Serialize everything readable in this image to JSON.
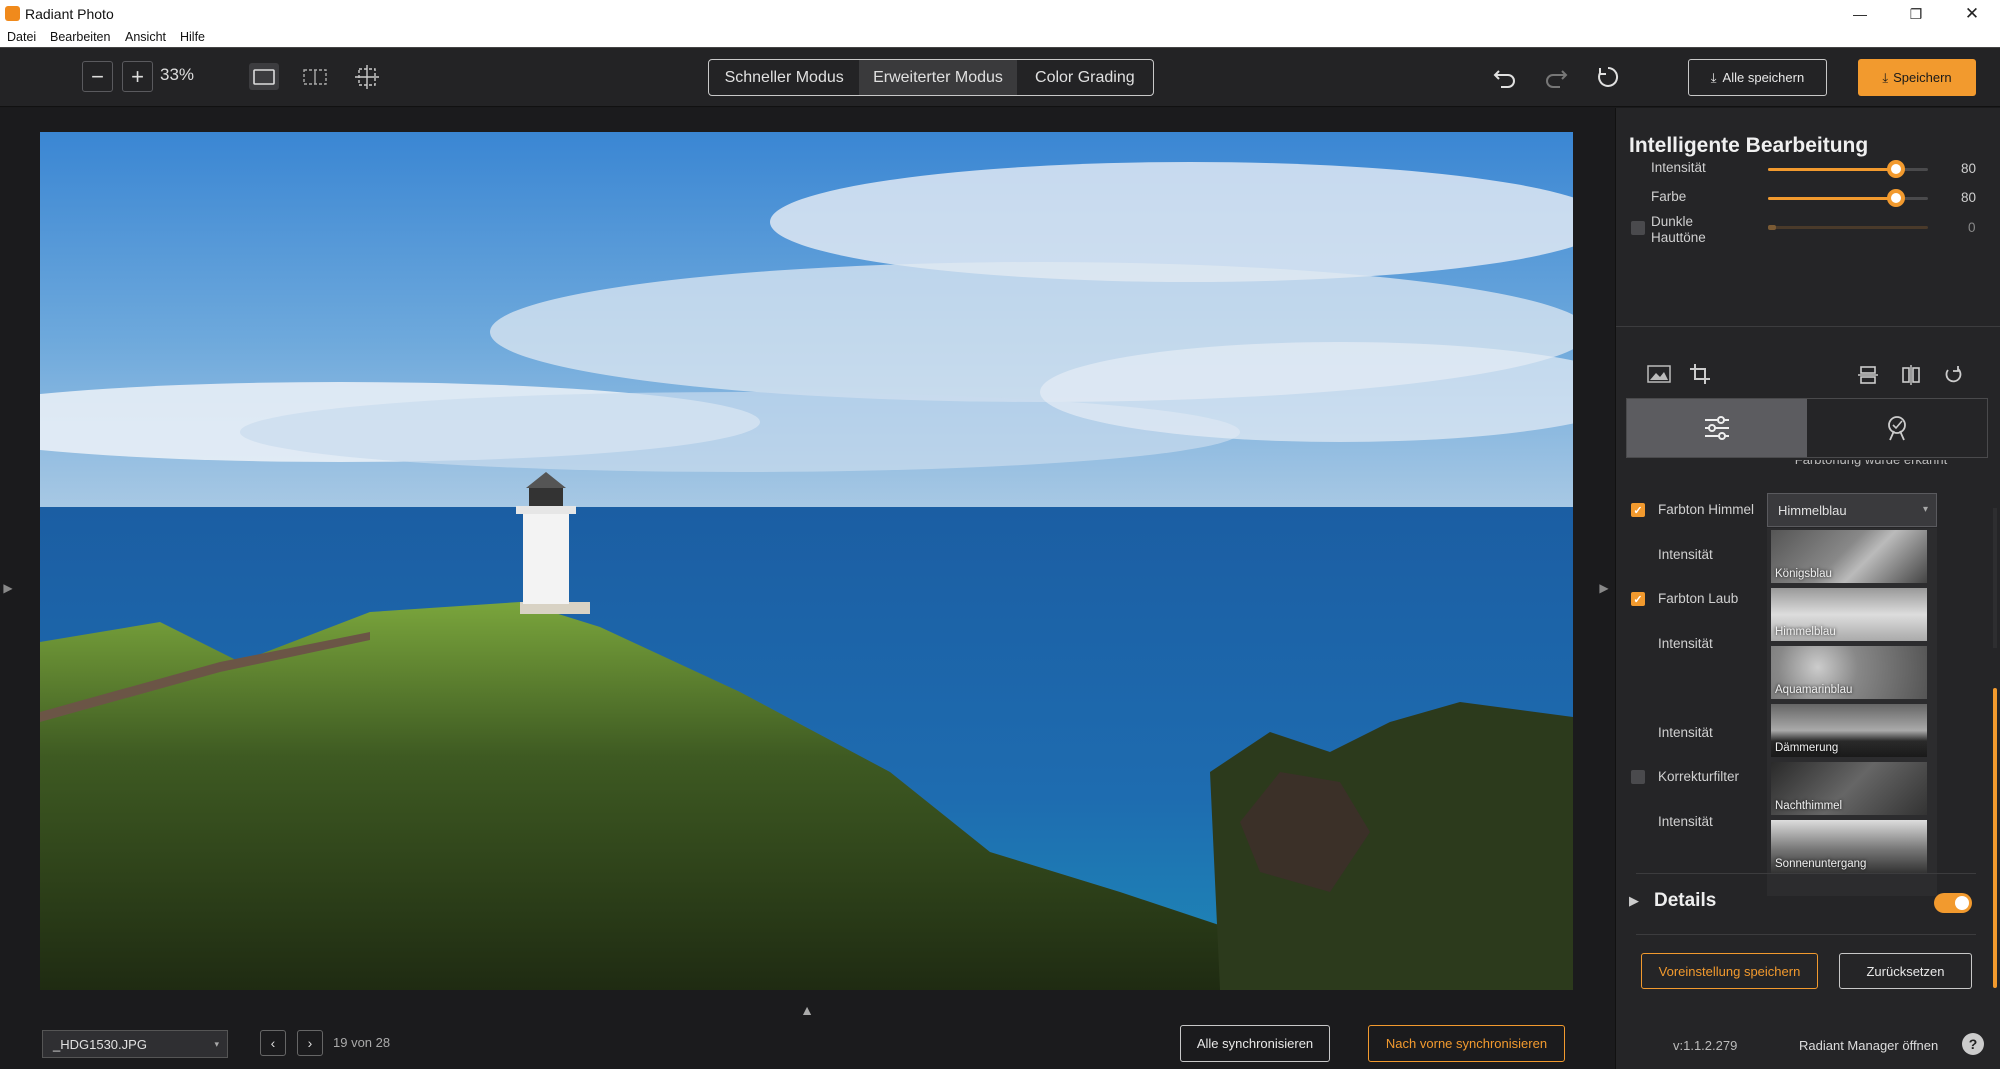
{
  "app": {
    "title": "Radiant Photo"
  },
  "menu": [
    "Datei",
    "Bearbeiten",
    "Ansicht",
    "Hilfe"
  ],
  "toolbar": {
    "zoom": "33%",
    "modes": [
      "Schneller Modus",
      "Erweiterter Modus",
      "Color Grading"
    ],
    "active_mode": "Erweiterter Modus",
    "save_all": "Alle speichern",
    "save": "Speichern"
  },
  "panel": {
    "title": "Intelligente Bearbeitung",
    "sliders": [
      {
        "label": "Intensität",
        "value": "80",
        "level": 0.8,
        "enabled": true
      },
      {
        "label": "Farbe",
        "value": "80",
        "level": 0.8,
        "enabled": true
      },
      {
        "label": "Dunkle\nHauttöne",
        "value": "0",
        "level": 0.0,
        "enabled": false
      }
    ],
    "clipped_text": "Farbtönung wurde erkannt",
    "adjustments": [
      {
        "label": "Farbton Himmel",
        "checked": true
      },
      {
        "label": "Intensität"
      },
      {
        "label": "Farbton Laub",
        "checked": true
      },
      {
        "label": "Intensität"
      },
      {
        "label": "Intensität"
      },
      {
        "label": "Korrekturfilter",
        "checked": false
      },
      {
        "label": "Intensität"
      }
    ],
    "sky_dropdown": {
      "selected": "Himmelblau",
      "options": [
        "Königsblau",
        "Himmelblau",
        "Aquamarinblau",
        "Dämmerung",
        "Nachthimmel",
        "Sonnenuntergang"
      ]
    },
    "details": {
      "label": "Details",
      "enabled": true
    },
    "save_preset": "Voreinstellung speichern",
    "reset": "Zurücksetzen",
    "version": "v:1.1.2.279",
    "manager": "Radiant Manager öffnen",
    "help": "?"
  },
  "bottom": {
    "filename": "_HDG1530.JPG",
    "counter": "19 von 28",
    "sync_all": "Alle synchronisieren",
    "sync_forward": "Nach vorne synchronisieren"
  },
  "colors": {
    "accent": "#f29a2e",
    "bg": "#1a1a1c",
    "panel": "#252527"
  }
}
